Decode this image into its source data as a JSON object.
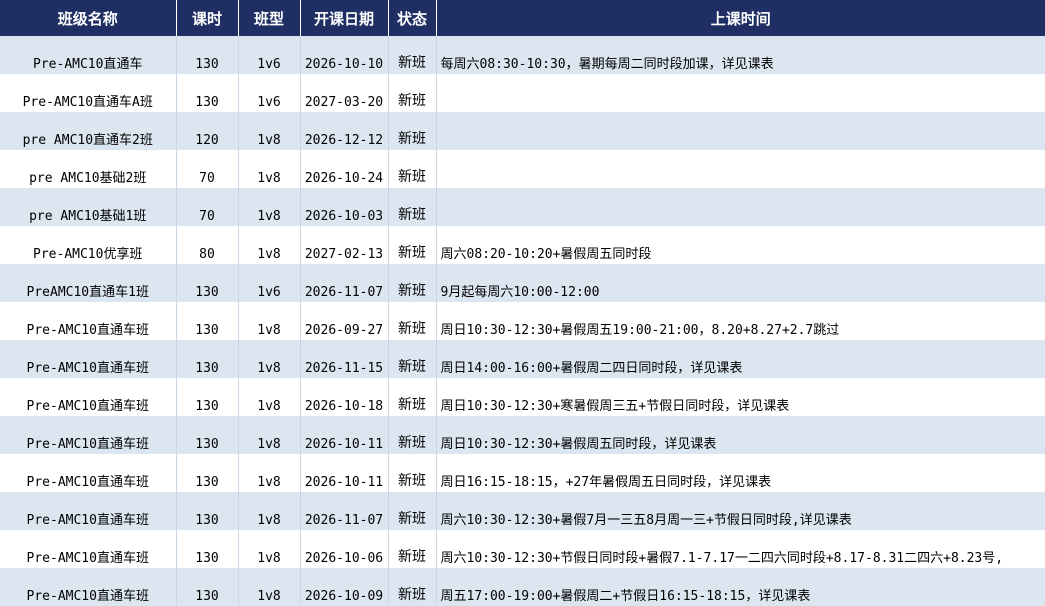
{
  "header": {
    "name": "班级名称",
    "hours": "课时",
    "type": "班型",
    "start": "开课日期",
    "status": "状态",
    "schedule": "上课时间"
  },
  "rows": [
    {
      "name": "Pre-AMC10直通车",
      "hours": "130",
      "type": "1v6",
      "start": "2026-10-10",
      "status": "新班",
      "schedule": "每周六08:30-10:30，暑期每周二同时段加课，详见课表"
    },
    {
      "name": "Pre-AMC10直通车A班",
      "hours": "130",
      "type": "1v6",
      "start": "2027-03-20",
      "status": "新班",
      "schedule": ""
    },
    {
      "name": "pre AMC10直通车2班",
      "hours": "120",
      "type": "1v8",
      "start": "2026-12-12",
      "status": "新班",
      "schedule": ""
    },
    {
      "name": "pre AMC10基础2班",
      "hours": "70",
      "type": "1v8",
      "start": "2026-10-24",
      "status": "新班",
      "schedule": ""
    },
    {
      "name": "pre AMC10基础1班",
      "hours": "70",
      "type": "1v8",
      "start": "2026-10-03",
      "status": "新班",
      "schedule": ""
    },
    {
      "name": "Pre-AMC10优享班",
      "hours": "80",
      "type": "1v8",
      "start": "2027-02-13",
      "status": "新班",
      "schedule": "周六08:20-10:20+暑假周五同时段"
    },
    {
      "name": "PreAMC10直通车1班",
      "hours": "130",
      "type": "1v6",
      "start": "2026-11-07",
      "status": "新班",
      "schedule": "9月起每周六10:00-12:00"
    },
    {
      "name": "Pre-AMC10直通车班",
      "hours": "130",
      "type": "1v8",
      "start": "2026-09-27",
      "status": "新班",
      "schedule": "周日10:30-12:30+暑假周五19:00-21:00，8.20+8.27+2.7跳过"
    },
    {
      "name": "Pre-AMC10直通车班",
      "hours": "130",
      "type": "1v8",
      "start": "2026-11-15",
      "status": "新班",
      "schedule": "周日14:00-16:00+暑假周二四日同时段，详见课表"
    },
    {
      "name": "Pre-AMC10直通车班",
      "hours": "130",
      "type": "1v8",
      "start": "2026-10-18",
      "status": "新班",
      "schedule": "周日10:30-12:30+寒暑假周三五+节假日同时段，详见课表"
    },
    {
      "name": "Pre-AMC10直通车班",
      "hours": "130",
      "type": "1v8",
      "start": "2026-10-11",
      "status": "新班",
      "schedule": "周日10:30-12:30+暑假周五同时段，详见课表"
    },
    {
      "name": "Pre-AMC10直通车班",
      "hours": "130",
      "type": "1v8",
      "start": "2026-10-11",
      "status": "新班",
      "schedule": "周日16:15-18:15，+27年暑假周五日同时段，详见课表"
    },
    {
      "name": "Pre-AMC10直通车班",
      "hours": "130",
      "type": "1v8",
      "start": "2026-11-07",
      "status": "新班",
      "schedule": "周六10:30-12:30+暑假7月一三五8月周一三+节假日同时段,详见课表"
    },
    {
      "name": "Pre-AMC10直通车班",
      "hours": "130",
      "type": "1v8",
      "start": "2026-10-06",
      "status": "新班",
      "schedule": "周六10:30-12:30+节假日同时段+暑假7.1-7.17一二四六同时段+8.17-8.31二四六+8.23号,"
    },
    {
      "name": "Pre-AMC10直通车班",
      "hours": "130",
      "type": "1v8",
      "start": "2026-10-09",
      "status": "新班",
      "schedule": "周五17:00-19:00+暑假周二+节假日16:15-18:15，详见课表"
    }
  ]
}
